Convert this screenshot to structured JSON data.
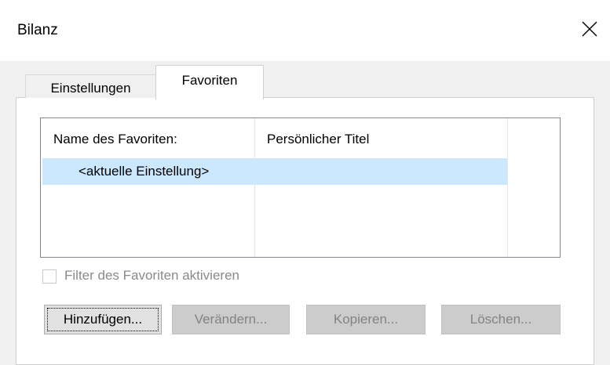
{
  "window": {
    "title": "Bilanz",
    "close_icon": "close-icon"
  },
  "tabs": [
    {
      "label": "Einstellungen",
      "active": false
    },
    {
      "label": "Favoriten",
      "active": true
    }
  ],
  "favorites_list": {
    "columns": [
      "Name des Favoriten:",
      "Persönlicher Titel"
    ],
    "rows": [
      {
        "name": "<aktuelle Einstellung>",
        "title": "",
        "selected": true
      }
    ],
    "selection_color": "#cce8ff"
  },
  "filter_checkbox": {
    "label": "Filter des Favoriten aktivieren",
    "checked": false,
    "enabled": false
  },
  "buttons": [
    {
      "label": "Hinzufügen...",
      "enabled": true
    },
    {
      "label": "Verändern...",
      "enabled": false
    },
    {
      "label": "Kopieren...",
      "enabled": false
    },
    {
      "label": "Löschen...",
      "enabled": false
    }
  ]
}
